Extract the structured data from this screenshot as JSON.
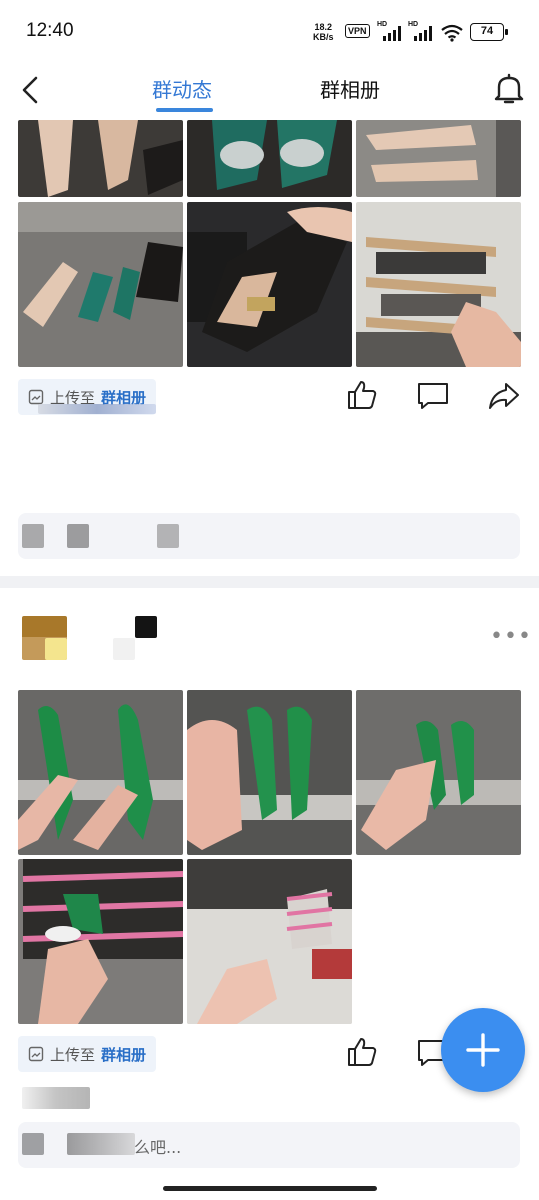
{
  "status_bar": {
    "time": "12:40",
    "net_speed_value": "18.2",
    "net_speed_unit": "KB/s",
    "vpn": "VPN",
    "hd1": "HD",
    "hd2": "HD",
    "battery": "74"
  },
  "nav": {
    "back_icon": "chevron-left-icon",
    "tabs": [
      {
        "label": "群动态",
        "active": true
      },
      {
        "label": "群相册",
        "active": false
      }
    ],
    "bell_icon": "bell-icon",
    "accent": "#3478d4"
  },
  "post1": {
    "upload_prefix": "上传至",
    "upload_album": "群相册"
  },
  "post2": {
    "more": "•••",
    "upload_prefix": "上传至",
    "upload_album": "群相册",
    "comment_placeholder": "么吧..."
  },
  "fab": {
    "icon": "plus-icon",
    "color": "#3b8ef0"
  }
}
